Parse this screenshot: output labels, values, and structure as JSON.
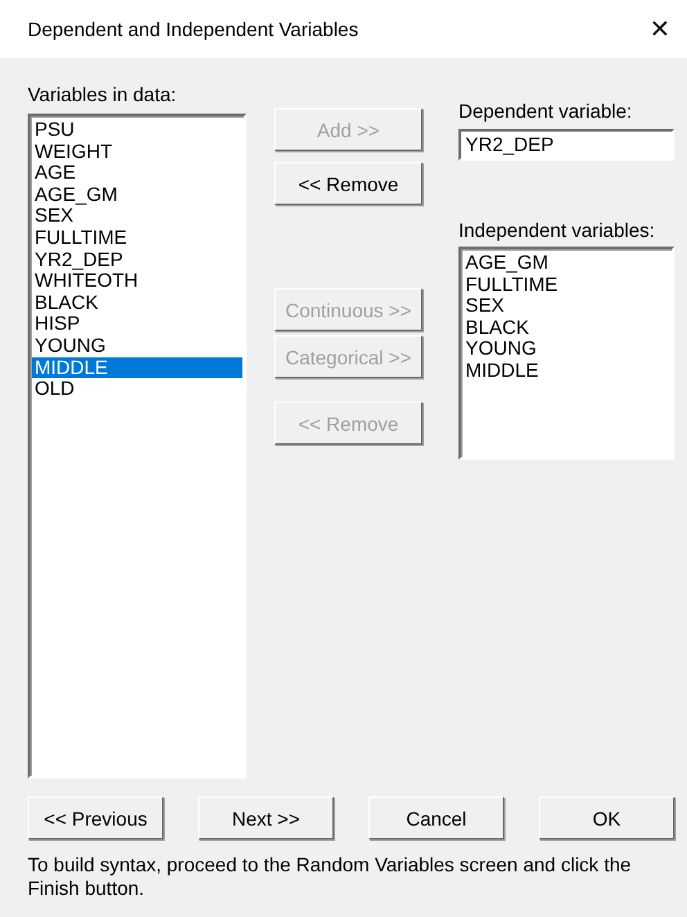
{
  "window": {
    "title": "Dependent and Independent Variables",
    "close": "✕"
  },
  "variables_label": "Variables in data:",
  "variables": [
    {
      "name": "PSU",
      "selected": false
    },
    {
      "name": "WEIGHT",
      "selected": false
    },
    {
      "name": "AGE",
      "selected": false
    },
    {
      "name": "AGE_GM",
      "selected": false
    },
    {
      "name": "SEX",
      "selected": false
    },
    {
      "name": "FULLTIME",
      "selected": false
    },
    {
      "name": "YR2_DEP",
      "selected": false
    },
    {
      "name": "WHITEOTH",
      "selected": false
    },
    {
      "name": "BLACK",
      "selected": false
    },
    {
      "name": "HISP",
      "selected": false
    },
    {
      "name": "YOUNG",
      "selected": false
    },
    {
      "name": "MIDDLE",
      "selected": true
    },
    {
      "name": "OLD",
      "selected": false
    }
  ],
  "dependent_buttons": [
    {
      "label": "Add >>",
      "disabled": true
    },
    {
      "label": "<< Remove",
      "disabled": false
    }
  ],
  "independent_buttons": [
    {
      "label": "Continuous >>",
      "disabled": true
    },
    {
      "label": "Categorical >>",
      "disabled": true
    }
  ],
  "independent_remove": {
    "label": "<< Remove",
    "disabled": true
  },
  "dependent_label": "Dependent variable:",
  "dependent_value": "YR2_DEP",
  "independent_label": "Independent variables:",
  "independent": [
    "AGE_GM",
    "FULLTIME",
    "SEX",
    "BLACK",
    "YOUNG",
    "MIDDLE"
  ],
  "buttons": [
    "<< Previous",
    "Next >>",
    "Cancel",
    "OK"
  ],
  "footer": "To build  syntax, proceed to the Random Variables screen and click  the Finish button."
}
